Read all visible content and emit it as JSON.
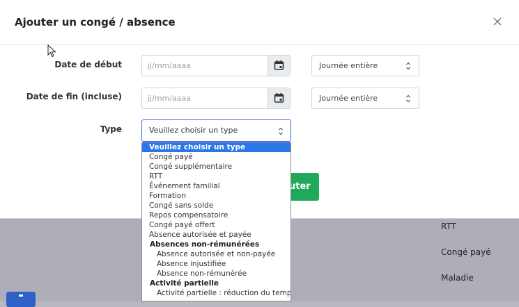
{
  "background": {
    "items": [
      "RTT",
      "Congé payé",
      "Maladie"
    ]
  },
  "modal": {
    "title": "Ajouter un congé / absence",
    "labels": {
      "start": "Date de début",
      "end": "Date de fin (incluse)",
      "type": "Type"
    },
    "start_date": {
      "placeholder": "jj/mm/aaaa",
      "period": "Journée entière"
    },
    "end_date": {
      "placeholder": "jj/mm/aaaa",
      "period": "Journée entière"
    },
    "type_select": {
      "value": "Veuillez choisir un type"
    },
    "submit_label": "uter"
  },
  "dropdown": {
    "options": [
      "Veuillez choisir un type",
      "Congé payé",
      "Congé supplémentaire",
      "RTT",
      "Événement familial",
      "Formation",
      "Congé sans solde",
      "Repos compensatoire",
      "Congé payé offert",
      "Absence autorisée et payée"
    ],
    "group1": {
      "label": "Absences non-rémunérées",
      "options": [
        "Absence autorisée et non-payée",
        "Absence injustifiée",
        "Absence non-rémunérée"
      ]
    },
    "group2": {
      "label": "Activité partielle",
      "options": [
        "Activité partielle : réduction du temps"
      ]
    }
  },
  "colors": {
    "accent": "#2a77e8",
    "submit": "#1eaa5a",
    "focus_border": "#4a63d6"
  },
  "icons": {
    "close": "close-icon",
    "calendar": "calendar-icon",
    "caret": "select-caret-icon",
    "cursor": "mouse-cursor-icon"
  }
}
